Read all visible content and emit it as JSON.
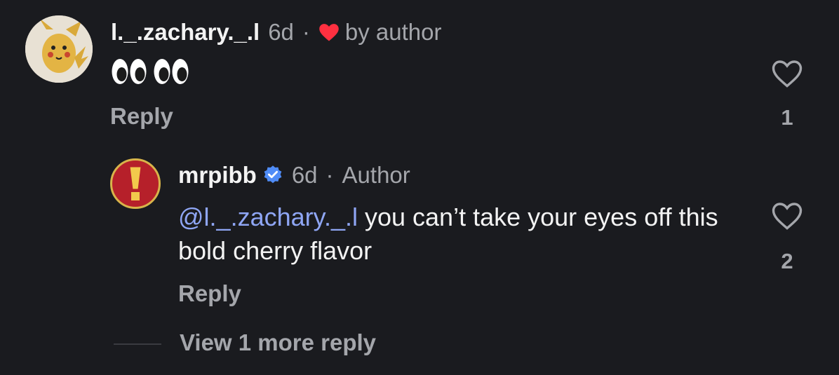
{
  "comment1": {
    "username": "l._.zachary._.l",
    "time": "6d",
    "separator": "·",
    "author_like_text": "by author",
    "body_emoji": "👀👀",
    "reply_label": "Reply",
    "like_count": "1",
    "avatar_icon": "pikachu-avatar"
  },
  "comment2": {
    "username": "mrpibb",
    "verified_icon": "verified-badge-icon",
    "time": "6d",
    "separator": "·",
    "author_label": "Author",
    "mention": "@l._.zachary._.l",
    "body_text": " you can’t take your eyes off this bold cherry flavor",
    "reply_label": "Reply",
    "like_count": "2",
    "avatar_icon": "exclamation-avatar"
  },
  "view_more_replies": "View 1 more reply",
  "colors": {
    "background": "#1a1b1f",
    "muted_text": "#a4a6ab",
    "mention": "#8fa6f4",
    "heart_red": "#ff3040",
    "verified_blue": "#4f8cf7"
  }
}
